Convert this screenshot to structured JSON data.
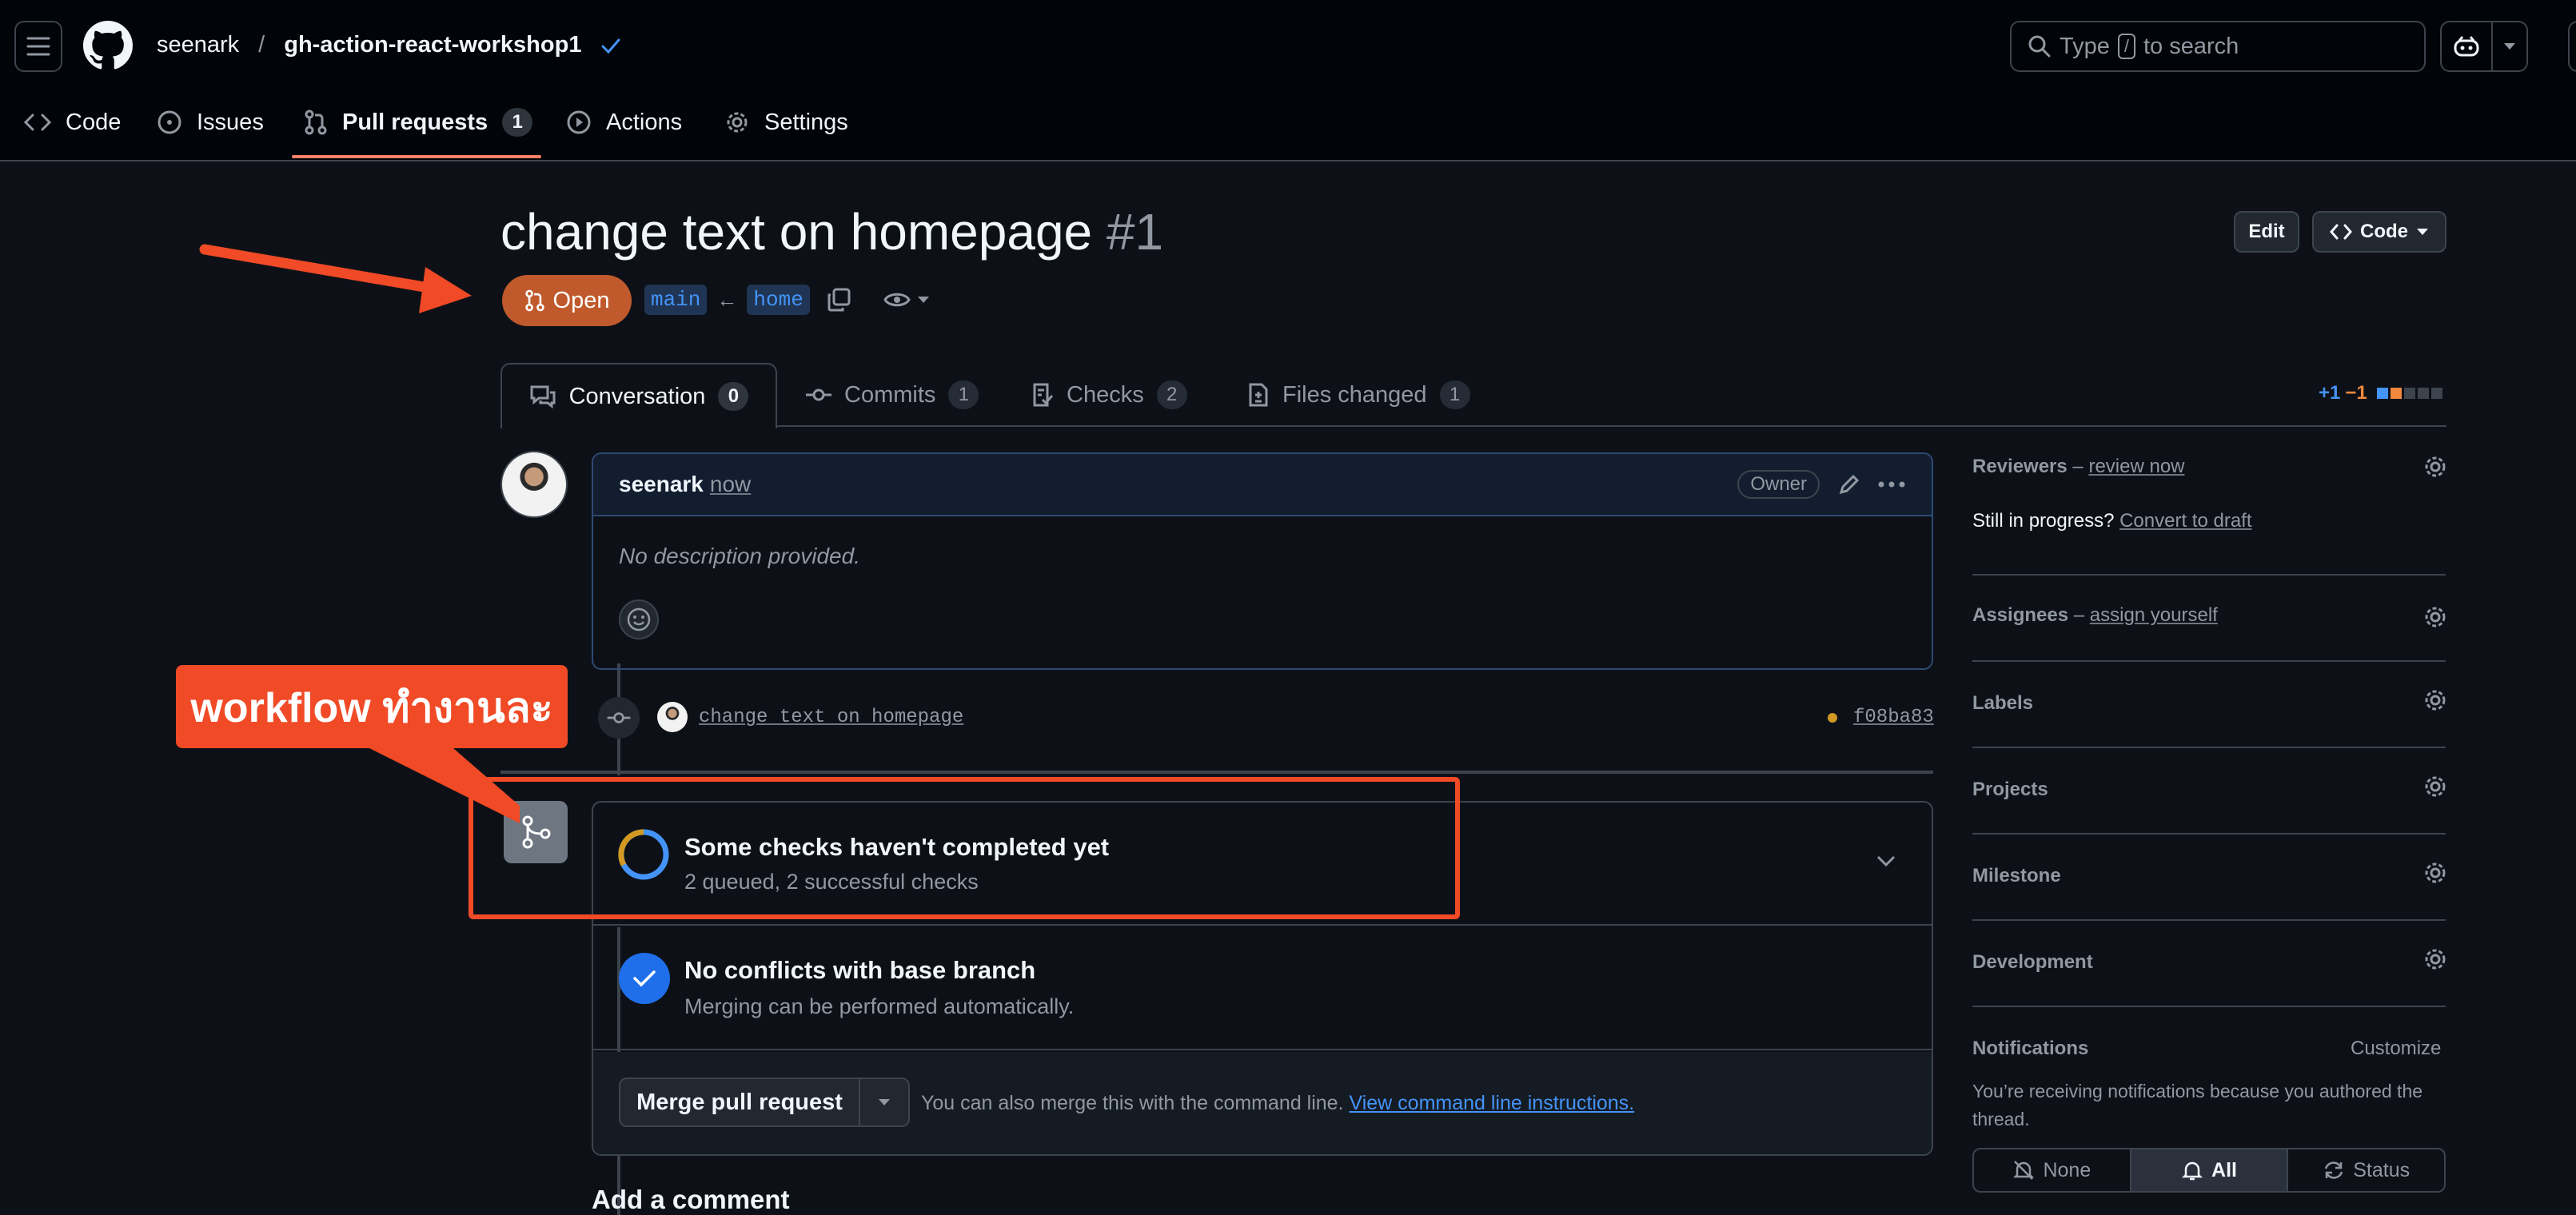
{
  "header": {
    "owner": "seenark",
    "separator": "/",
    "repo": "gh-action-react-workshop1",
    "search_prefix": "Type",
    "search_key": "/",
    "search_suffix": "to search"
  },
  "repo_nav": {
    "code": "Code",
    "issues": "Issues",
    "pulls": "Pull requests",
    "pulls_count": "1",
    "actions": "Actions",
    "settings": "Settings"
  },
  "pr": {
    "title": "change text on homepage",
    "number": "#1",
    "state": "Open",
    "base": "main",
    "arrow": "←",
    "head": "home",
    "edit": "Edit",
    "code": "Code"
  },
  "tabs": [
    {
      "label": "Conversation",
      "count": "0"
    },
    {
      "label": "Commits",
      "count": "1"
    },
    {
      "label": "Checks",
      "count": "2"
    },
    {
      "label": "Files changed",
      "count": "1"
    }
  ],
  "diffstat": {
    "add": "+1",
    "del": "−1"
  },
  "comment": {
    "author": "seenark",
    "time": "now",
    "role": "Owner",
    "body": "No description provided."
  },
  "commit": {
    "message": "change text on homepage",
    "sha": "f08ba83"
  },
  "annotation": {
    "text": "workflow ทำงานละ"
  },
  "checks": {
    "title": "Some checks haven't completed yet",
    "subtitle": "2 queued, 2 successful checks"
  },
  "conflicts": {
    "title": "No conflicts with base branch",
    "subtitle": "Merging can be performed automatically."
  },
  "merge": {
    "button": "Merge pull request",
    "hint": "You can also merge this with the command line.",
    "link": "View command line instructions."
  },
  "add_comment": "Add a comment",
  "sidebar": {
    "reviewers": "Reviewers",
    "dash": "–",
    "review_now": "review now",
    "still_progress": "Still in progress?",
    "convert": "Convert to draft",
    "assignees": "Assignees",
    "assign_yourself": "assign yourself",
    "labels": "Labels",
    "projects": "Projects",
    "milestone": "Milestone",
    "development": "Development",
    "notifications": "Notifications",
    "customize": "Customize",
    "notif_text": "You’re receiving notifications because you authored the thread.",
    "opt_none": "None",
    "opt_all": "All",
    "opt_status": "Status"
  },
  "colors": {
    "open_badge": "#c05a2d",
    "annotation": "#f04a26",
    "accent": "#4493f8",
    "pending": "#d29922"
  },
  "icons": [
    "hamburger-icon",
    "github-logo-icon",
    "verified-check-icon",
    "search-icon",
    "copilot-icon",
    "code-icon",
    "issue-icon",
    "pull-request-icon",
    "play-icon",
    "gear-icon",
    "copy-icon",
    "eye-icon",
    "comment-icon",
    "commit-icon",
    "checklist-icon",
    "file-diff-icon",
    "pencil-icon",
    "kebab-icon",
    "smiley-icon",
    "git-merge-icon",
    "chevron-down-icon",
    "check-icon",
    "bell-slash-icon",
    "bell-icon",
    "sync-icon"
  ]
}
